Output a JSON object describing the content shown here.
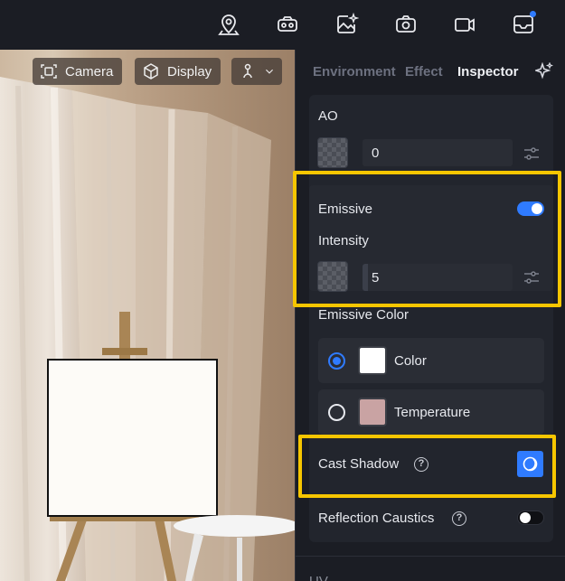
{
  "topbar": {
    "icons": [
      "map-pin-icon",
      "vr-headset-icon",
      "ai-image-icon",
      "camera-icon",
      "video-icon",
      "inbox-icon"
    ],
    "has_notification": true
  },
  "viewport": {
    "camera_label": "Camera",
    "display_label": "Display"
  },
  "panel": {
    "tabs": [
      "Environment",
      "Effect",
      "Inspector"
    ],
    "active_tab": "Inspector",
    "ao": {
      "label": "AO",
      "value": "0"
    },
    "emissive": {
      "label": "Emissive",
      "enabled": true,
      "intensity_label": "Intensity",
      "intensity_value": "5",
      "color_label": "Emissive Color",
      "options": [
        {
          "label": "Color",
          "selected": true,
          "swatch": "#ffffff"
        },
        {
          "label": "Temperature",
          "selected": false,
          "swatch": "#c9a3a3"
        }
      ]
    },
    "cast_shadow": {
      "label": "Cast Shadow",
      "enabled": true
    },
    "reflection_caustics": {
      "label": "Reflection Caustics",
      "enabled": false
    },
    "next_section_label": "UV"
  },
  "colors": {
    "accent": "#2f7bff",
    "highlight": "#f7c600",
    "panel_bg": "#1b1d24",
    "card_bg": "#22252d"
  }
}
